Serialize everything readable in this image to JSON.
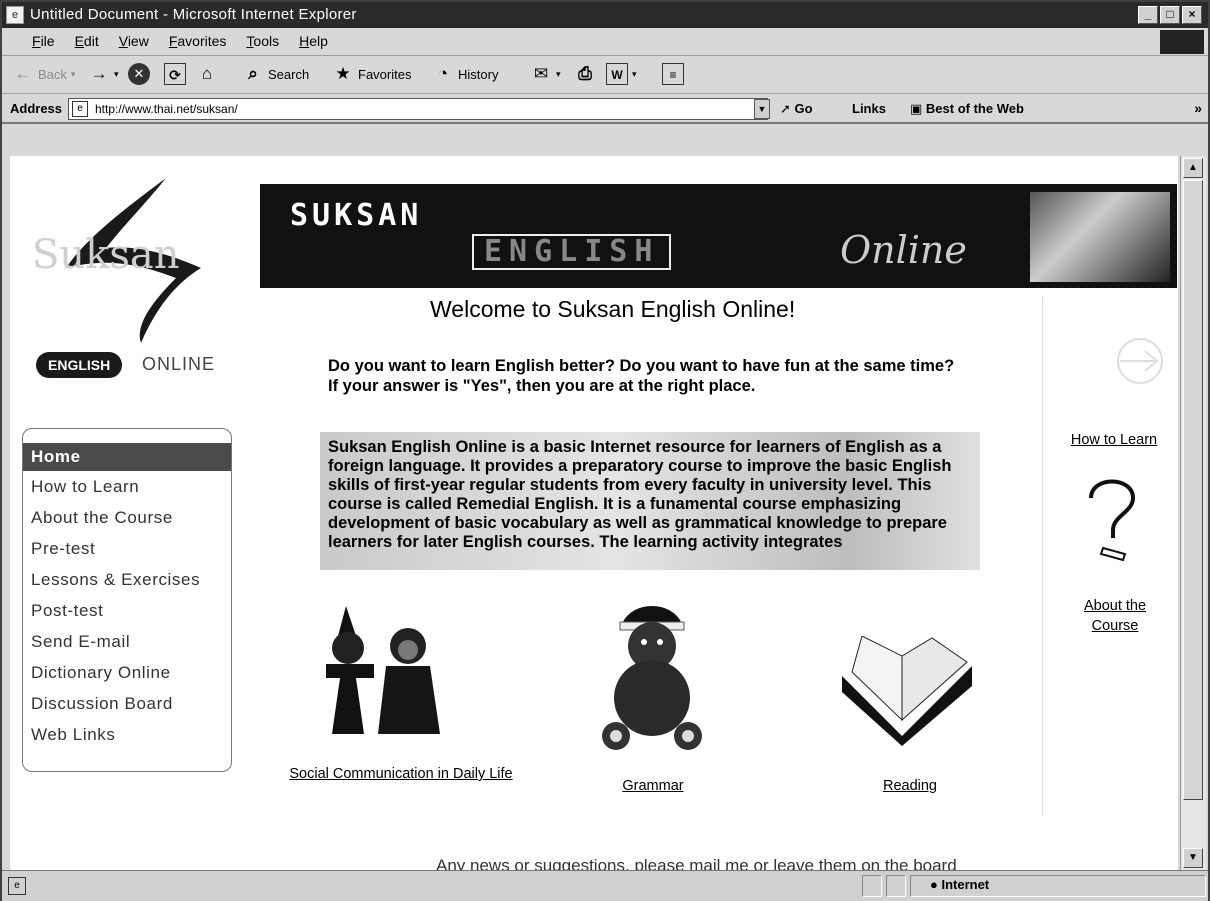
{
  "window": {
    "title": "Untitled Document - Microsoft Internet Explorer",
    "buttons": [
      "_",
      "□",
      "×"
    ]
  },
  "menu": [
    "File",
    "Edit",
    "View",
    "Favorites",
    "Tools",
    "Help"
  ],
  "toolbar": {
    "back": "Back",
    "search": "Search",
    "favorites": "Favorites",
    "history": "History"
  },
  "address": {
    "label": "Address",
    "url": "http://www.thai.net/suksan/",
    "go": "Go",
    "links": "Links",
    "best": "Best of the Web"
  },
  "logo": {
    "text": "Suksan",
    "badge": "ENGLISH",
    "online": "ONLINE"
  },
  "nav": [
    "Home",
    "How to Learn",
    "About the Course",
    "Pre-test",
    "Lessons & Exercises",
    "Post-test",
    "Send E-mail",
    "Dictionary Online",
    "Discussion Board",
    "Web Links"
  ],
  "banner": {
    "line1": "SUKSAN",
    "line2": "ENGLISH",
    "line3": "Online"
  },
  "main": {
    "welcome": "Welcome to Suksan English Online!",
    "para1": "Do you want to learn English better? Do you want to have fun at the same time? If your answer is \"Yes\", then you are at the right place.",
    "para2": "Suksan English Online is a basic Internet resource for learners of English as a foreign language. It provides a preparatory course to improve the basic English skills of first-year regular students from every faculty in university level. This course is called Remedial English. It is a funamental course emphasizing development of basic vocabulary as well as grammatical knowledge to prepare learners for later English courses. The learning activity integrates",
    "cat1": "Social Communication in Daily Life",
    "cat2": "Grammar",
    "cat3": "Reading",
    "footer": "Any news or suggestions, please mail me or leave them on the board"
  },
  "sidebar": {
    "how": "How to Learn",
    "about": "About the Course"
  },
  "status": {
    "zone": "Internet"
  },
  "colors": {
    "titlebar": "#2a2a2a",
    "chrome": "#d8d8d8",
    "banner": "#111111",
    "nav_active": "#4a4a4a"
  }
}
